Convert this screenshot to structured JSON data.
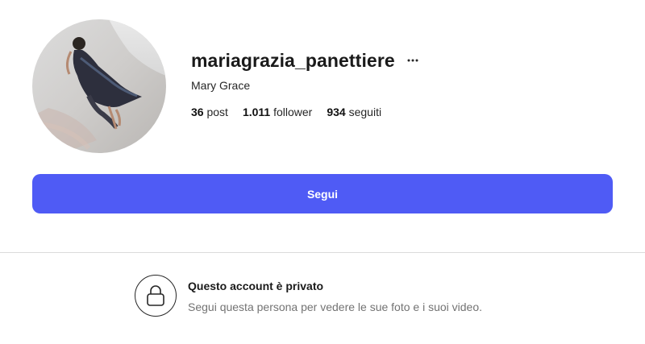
{
  "profile": {
    "username": "mariagrazia_panettiere",
    "full_name": "Mary Grace",
    "more_icon": "more-horizontal-icon",
    "avatar_icon": "profile-photo"
  },
  "stats": {
    "posts_count": "36",
    "posts_label": "post",
    "followers_count": "1.011",
    "followers_label": "follower",
    "following_count": "934",
    "following_label": "seguiti"
  },
  "actions": {
    "follow_label": "Segui",
    "follow_color": "#4f5bf5"
  },
  "private_notice": {
    "icon": "lock-icon",
    "title": "Questo account è privato",
    "description": "Segui questa persona per vedere le sue foto e i suoi video."
  }
}
